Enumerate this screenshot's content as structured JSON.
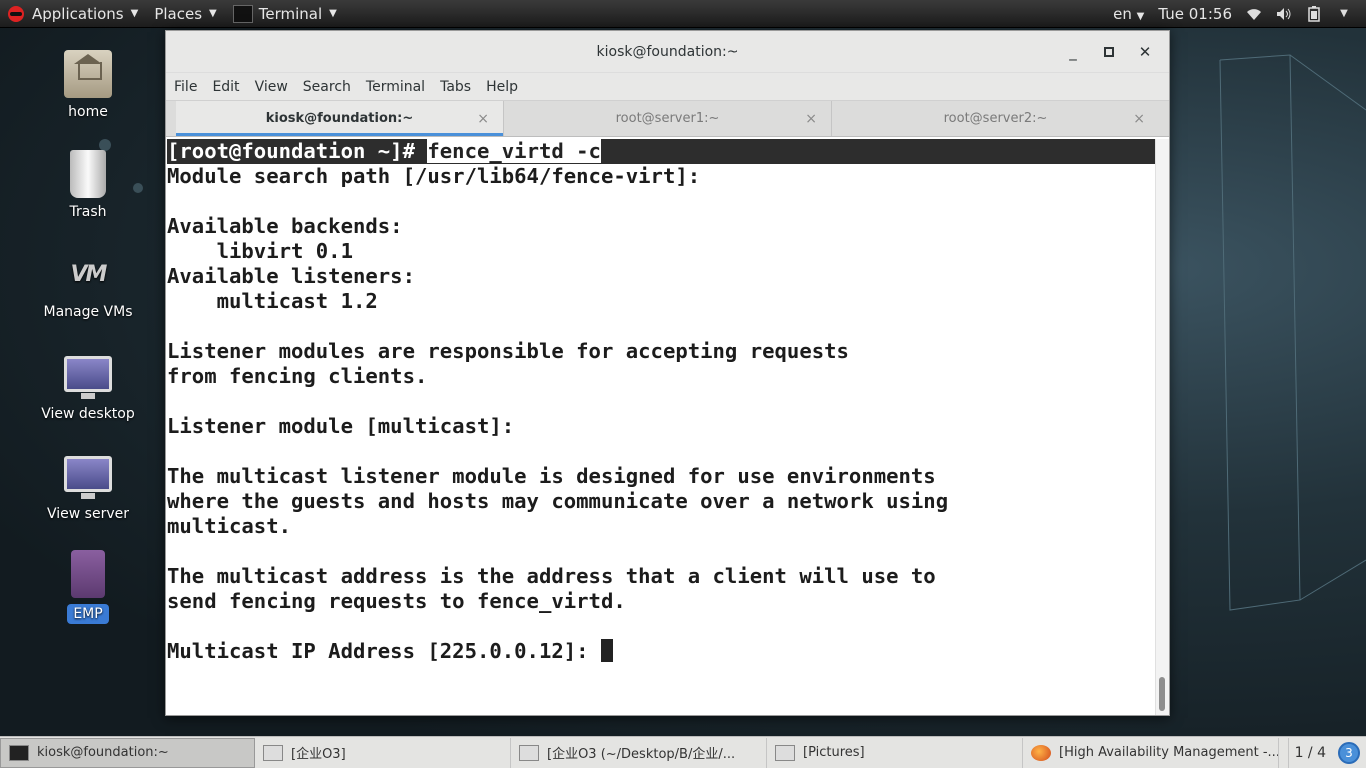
{
  "top_panel": {
    "applications": "Applications",
    "places": "Places",
    "terminal": "Terminal",
    "lang": "en",
    "clock": "Tue 01:56",
    "icons": [
      "wifi-icon",
      "volume-icon",
      "battery-icon"
    ]
  },
  "desktop": {
    "icons": [
      {
        "label": "home",
        "icon": "home-folder-icon"
      },
      {
        "label": "Trash",
        "icon": "trash-icon"
      },
      {
        "label": "Manage VMs",
        "icon": "vm-manager-icon"
      },
      {
        "label": "View desktop",
        "icon": "monitor-icon"
      },
      {
        "label": "View server",
        "icon": "monitor-icon"
      },
      {
        "label": "EMP",
        "icon": "emp-icon"
      }
    ]
  },
  "window": {
    "title": "kiosk@foundation:~",
    "menu": [
      "File",
      "Edit",
      "View",
      "Search",
      "Terminal",
      "Tabs",
      "Help"
    ],
    "tabs": [
      {
        "label": "kiosk@foundation:~",
        "active": true
      },
      {
        "label": "root@server1:~",
        "active": false
      },
      {
        "label": "root@server2:~",
        "active": false
      }
    ],
    "prompt": "[root@foundation ~]# ",
    "command": "fence_virtd -c",
    "lines": [
      "Module search path [/usr/lib64/fence-virt]:",
      "",
      "Available backends:",
      "    libvirt 0.1",
      "Available listeners:",
      "    multicast 1.2",
      "",
      "Listener modules are responsible for accepting requests",
      "from fencing clients.",
      "",
      "Listener module [multicast]:",
      "",
      "The multicast listener module is designed for use environments",
      "where the guests and hosts may communicate over a network using",
      "multicast.",
      "",
      "The multicast address is the address that a client will use to",
      "send fencing requests to fence_virtd.",
      ""
    ],
    "last_prompt": "Multicast IP Address [225.0.0.12]: "
  },
  "taskbar": {
    "tasks": [
      {
        "label": "kiosk@foundation:~",
        "icon": "terminal-icon",
        "active": true
      },
      {
        "label": "[企业O3]",
        "icon": "window-icon",
        "active": false
      },
      {
        "label": "[企业O3 (~/Desktop/B/企业/...",
        "icon": "text-editor-icon",
        "active": false
      },
      {
        "label": "[Pictures]",
        "icon": "window-icon",
        "active": false
      },
      {
        "label": "[High Availability Management -...",
        "icon": "firefox-icon",
        "active": false
      }
    ],
    "workspace": "1 / 4",
    "badge": "3"
  }
}
